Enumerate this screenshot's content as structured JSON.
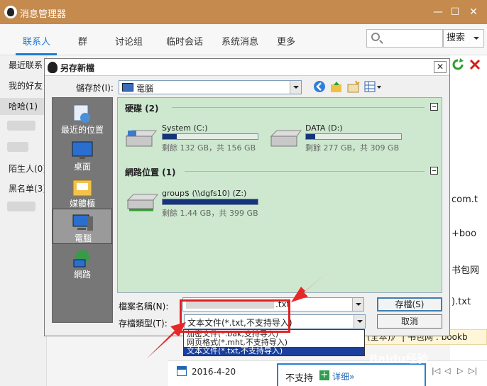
{
  "app": {
    "title": "消息管理器",
    "controls": [
      "—",
      "☐",
      "✕"
    ]
  },
  "tabs": [
    "联系人",
    "群",
    "讨论组",
    "临时会话",
    "系统消息",
    "更多"
  ],
  "search": {
    "placeholder": "",
    "button": "搜索"
  },
  "sidebar": {
    "items": [
      "最近联系",
      "我的好友",
      "哈哈(1)",
      "陌生人(0)",
      "黑名单(3)"
    ]
  },
  "right_fragments": [
    "com.t",
    "+boo",
    "书包网",
    ").txt"
  ],
  "bottom": {
    "date": "2016-4-20",
    "not_support": "不支持",
    "detail_link": "详细»",
    "behind_text": "(全本)》 | 书包网 : bookb",
    "nav": [
      "|◁",
      "◁",
      "▷",
      "▷|"
    ]
  },
  "dialog": {
    "title": "另存新檔",
    "save_in_label": "儲存於(I):",
    "save_in_value": "電腦",
    "places": [
      "最近的位置",
      "桌面",
      "媒體櫃",
      "電腦",
      "網路"
    ],
    "groups": {
      "disks": "硬碟 (2)",
      "network": "網路位置 (1)"
    },
    "drives": [
      {
        "name": "System (C:)",
        "free": "剩餘 132 GB，共 156 GB",
        "used_fraction": 0.15
      },
      {
        "name": "DATA (D:)",
        "free": "剩餘 277 GB，共 309 GB",
        "used_fraction": 0.1
      },
      {
        "name": "group$ (\\\\dgfs10) (Z:)",
        "free": "剩餘 1.44 GB，共 399 GB",
        "used_fraction": 1.0
      }
    ],
    "filename_label": "檔案名稱(N):",
    "filename_value": ".txt",
    "filetype_label": "存檔類型(T):",
    "filetype_value": "文本文件(*.txt,不支持导入)",
    "save_button": "存檔(S)",
    "cancel_button": "取消",
    "type_options": [
      "加密文件(*.bak,支持导入)",
      "网页格式(*.mht,不支持导入)",
      "文本文件(*.txt,不支持导入)"
    ]
  },
  "watermark": "Baidu经验"
}
